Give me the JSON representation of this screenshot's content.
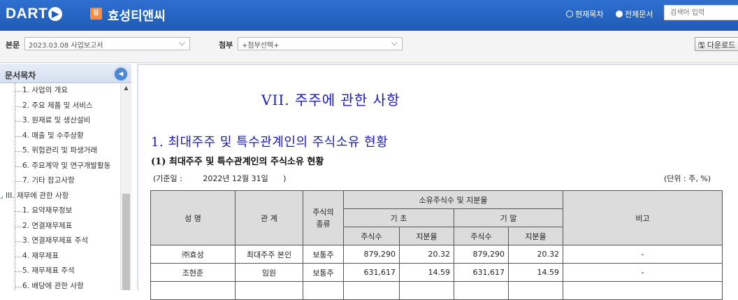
{
  "header": {
    "logo": "DART",
    "corp_badge": "유",
    "corp_name": "효성티앤씨",
    "radio_current": "현재목차",
    "radio_all": "전체문서",
    "search_placeholder": "검색어 입력"
  },
  "toolbar": {
    "main_label": "본문",
    "main_select": "2023.03.08  사업보고서",
    "attach_label": "첨부",
    "attach_select": "+첨부선택+",
    "download_label": "다운로드"
  },
  "sidebar": {
    "title": "문서목차",
    "items": [
      {
        "label": "1. 사업의 개요",
        "type": "child"
      },
      {
        "label": "2. 주요 제품 및 서비스",
        "type": "child"
      },
      {
        "label": "3. 원재료 및 생산설비",
        "type": "child"
      },
      {
        "label": "4. 매출 및 수주상황",
        "type": "child"
      },
      {
        "label": "5. 위험관리 및 파생거래",
        "type": "child"
      },
      {
        "label": "6. 주요계약 및 연구개발활동",
        "type": "child"
      },
      {
        "label": "7. 기타 참고사항",
        "type": "child"
      },
      {
        "label": "III. 재무에 관한 사항",
        "type": "section"
      },
      {
        "label": "1. 요약재무정보",
        "type": "child"
      },
      {
        "label": "2. 연결재무제표",
        "type": "child"
      },
      {
        "label": "3. 연결재무제표 주석",
        "type": "child"
      },
      {
        "label": "4. 재무제표",
        "type": "child"
      },
      {
        "label": "5. 재무제표 주석",
        "type": "child"
      },
      {
        "label": "6. 배당에 관한 사항",
        "type": "child"
      }
    ]
  },
  "document": {
    "title": "VII. 주주에 관한 사항",
    "section_heading": "1. 최대주주 및 특수관계인의 주식소유 현황",
    "sub_heading": "(1) 최대주주 및 특수관계인의 주식소유 현황",
    "basis_label": "(기준일 :",
    "basis_date": "2022년 12월 31일",
    "basis_close": ")",
    "unit": "(단위 : 주, %)",
    "table": {
      "h_name": "성 명",
      "h_relation": "관 계",
      "h_stock_type": "주식의\n종류",
      "h_ownership": "소유주식수 및 지분율",
      "h_begin": "기 초",
      "h_end": "기 말",
      "h_shares": "주식수",
      "h_ratio": "지분율",
      "h_note": "비고",
      "rows": [
        {
          "name": "㈜효성",
          "relation": "최대주주 본인",
          "type": "보통주",
          "begin_shares": "879,290",
          "begin_ratio": "20.32",
          "end_shares": "879,290",
          "end_ratio": "20.32",
          "note": "-"
        },
        {
          "name": "조현준",
          "relation": "임원",
          "type": "보통주",
          "begin_shares": "631,617",
          "begin_ratio": "14.59",
          "end_shares": "631,617",
          "end_ratio": "14.59",
          "note": "-"
        }
      ]
    }
  }
}
